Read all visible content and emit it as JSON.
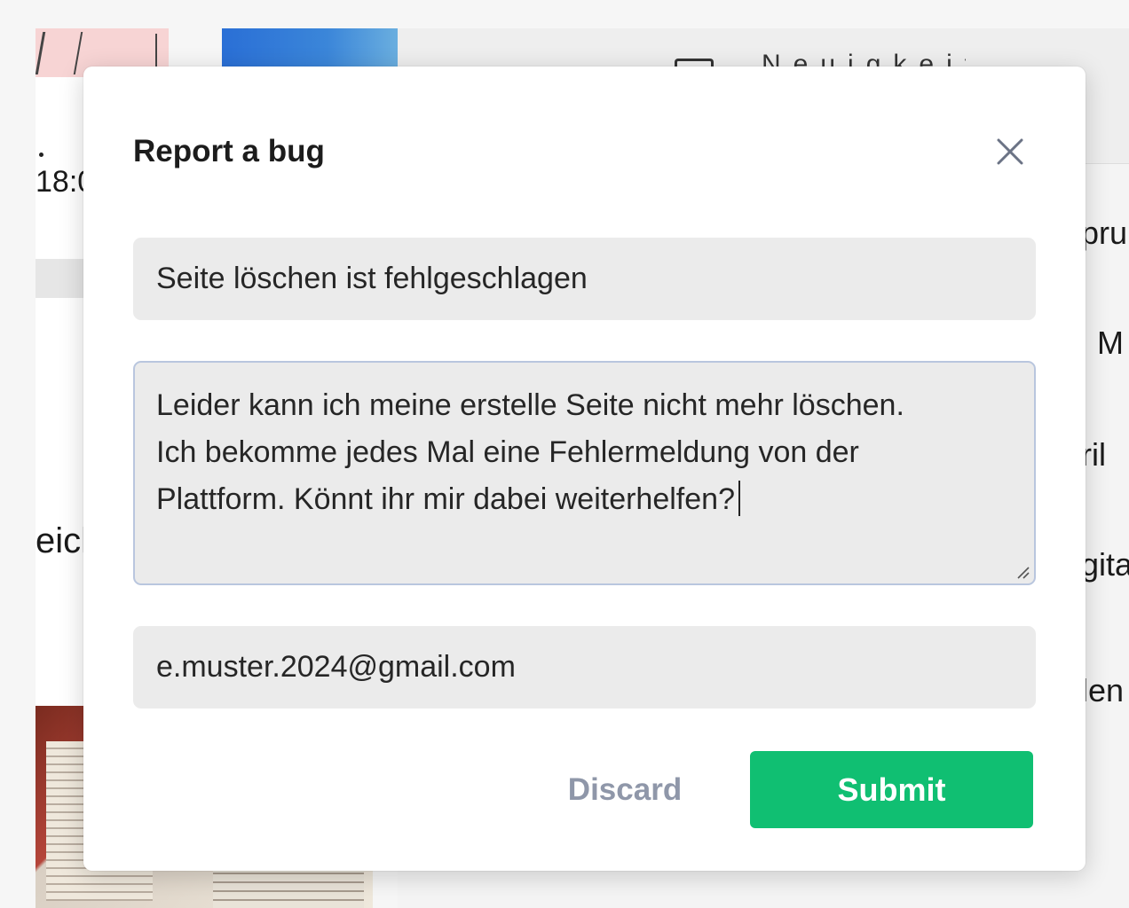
{
  "background": {
    "left_time": "18:0",
    "left_word": "eich",
    "header_text": "Neuigkeit",
    "right_words": [
      "pru",
      "M",
      "ril",
      "gita",
      "len"
    ]
  },
  "modal": {
    "title": "Report a bug",
    "title_field": {
      "value": "Seite löschen ist fehlgeschlagen"
    },
    "description_field": {
      "value": "Leider kann ich meine erstelle Seite nicht mehr löschen.\nIch bekomme jedes Mal eine Fehlermeldung von der\nPlattform. Könnt ihr mir dabei weiterhelfen?"
    },
    "email_field": {
      "value": "e.muster.2024@gmail.com"
    },
    "discard_label": "Discard",
    "submit_label": "Submit"
  },
  "colors": {
    "submit_bg": "#10bf72",
    "discard_text": "#8f97a9",
    "field_bg": "#ebebeb",
    "focus_border": "#b9c6de"
  },
  "icons": {
    "close": "close-icon",
    "calendar": "calendar-icon",
    "resize": "resize-handle-icon"
  }
}
